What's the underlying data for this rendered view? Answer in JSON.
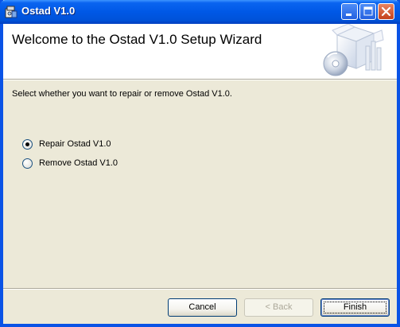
{
  "window": {
    "title": "Ostad V1.0",
    "controls": [
      "minimize",
      "maximize",
      "close"
    ]
  },
  "header": {
    "title": "Welcome to the Ostad V1.0 Setup Wizard",
    "art_icon": "installer-box-cd-icon"
  },
  "body": {
    "instruction": "Select whether you want to repair or remove Ostad V1.0.",
    "options": [
      {
        "label": "Repair Ostad V1.0",
        "selected": true
      },
      {
        "label": "Remove Ostad V1.0",
        "selected": false
      }
    ]
  },
  "buttons": {
    "cancel": "Cancel",
    "back": "< Back",
    "finish": "Finish"
  },
  "colors": {
    "titlebar": "#0058e6",
    "frame": "#0a53e6",
    "dialog": "#ece9d8",
    "radio_selected": "#21a121"
  }
}
